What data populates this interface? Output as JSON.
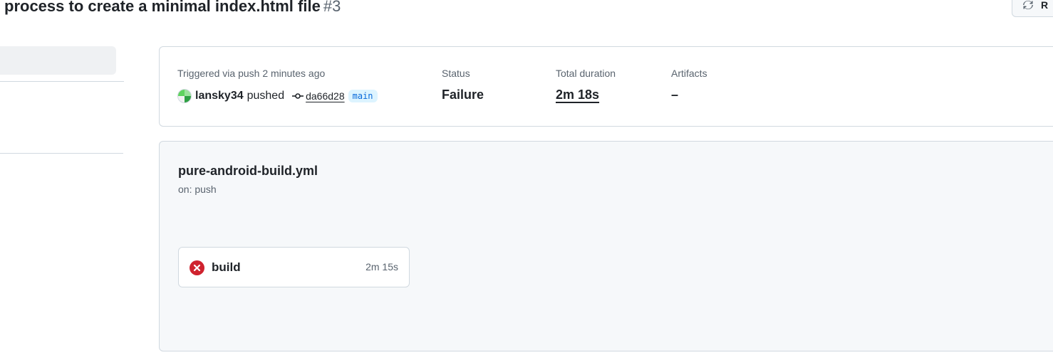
{
  "header": {
    "title": "process to create a minimal index.html file",
    "run_number": "#3",
    "rerun_label": "R",
    "rerun_icon": "sync-icon"
  },
  "summary": {
    "trigger_label": "Triggered via push 2 minutes ago",
    "actor": "lansky34",
    "action": "pushed",
    "commit_icon": "git-commit-icon",
    "commit_sha": "da66d28",
    "branch": "main",
    "status_label": "Status",
    "status_value": "Failure",
    "duration_label": "Total duration",
    "duration_value": "2m 18s",
    "artifacts_label": "Artifacts",
    "artifacts_value": "–"
  },
  "workflow": {
    "file_name": "pure-android-build.yml",
    "trigger": "on: push",
    "jobs": [
      {
        "name": "build",
        "duration": "2m 15s",
        "status": "failure",
        "status_icon": "x-circle-fill-icon"
      }
    ]
  },
  "colors": {
    "failure": "#cf222e",
    "accent_link": "#0969da",
    "branch_bg": "#ddf4ff",
    "muted_text": "#59636e",
    "border": "#d1d9e0",
    "canvas_subtle": "#f6f8fa"
  }
}
